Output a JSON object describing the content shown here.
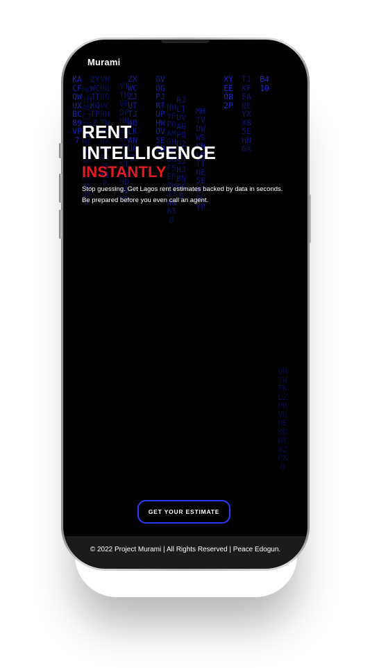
{
  "app": {
    "brand": "Murami"
  },
  "hero": {
    "line1": "RENT",
    "line2": "INTELLIGENCE",
    "accent": "INSTANTLY",
    "sub1": "Stop guessing. Get Lagos rent estimates backed by data in seconds.",
    "sub2": "Be prepared before you even call an agent."
  },
  "cta": {
    "label": "GET YOUR ESTIMATE"
  },
  "footer": {
    "text": "© 2022 Project Murami | All Rights Reserved | Peace Edogun."
  },
  "colors": {
    "background": "#000000",
    "accent_red": "#e21b23",
    "accent_blue": "#2c3cff",
    "rain_blue": "#1f2bd6",
    "footer_bg": "#1b1b1b",
    "text": "#ffffff"
  },
  "matrix_rain": {
    "columns": [
      {
        "chars": "ZYWCJTKQTPZ",
        "tone": "bright"
      },
      {
        "chars": "KACFQWUXBC89VP7",
        "tone": "bright"
      },
      {
        "chars": "MGYHAUCJZUHBMFUNIX8KDJNGDEP",
        "tone": "dim"
      },
      {
        "chars": "VHDQRQVCRHTNXVDXHWP47FM1P",
        "tone": "dim"
      },
      {
        "chars": "YTTMVPDFHNZCLKYVNOST0G9D0D5S",
        "tone": "dim"
      },
      {
        "chars": "ZXWCZJUTTJ4QLKANU03",
        "tone": "bright"
      },
      {
        "chars": "NHYFPQAMGHMSBHF5EFPWJ7ARA30",
        "tone": "dim"
      },
      {
        "chars": "GVOGPJRTUPHWOV5E5D",
        "tone": "bright"
      },
      {
        "chars": "RJLTUVA8PQD2TSSJHJBNKSS",
        "tone": "dim"
      },
      {
        "chars": "MHTVDWWSKNLKTTNE5E37GLYP",
        "tone": "dim"
      },
      {
        "chars": "XYEE082P",
        "tone": "bright"
      },
      {
        "chars": "TJKFFAQCYXX85EHNGX",
        "tone": "dim"
      },
      {
        "chars": "B410",
        "tone": "bright"
      },
      {
        "chars": "QHTWFKLZPRVGNEKDWYAZPXQ",
        "tone": "dim"
      }
    ]
  }
}
